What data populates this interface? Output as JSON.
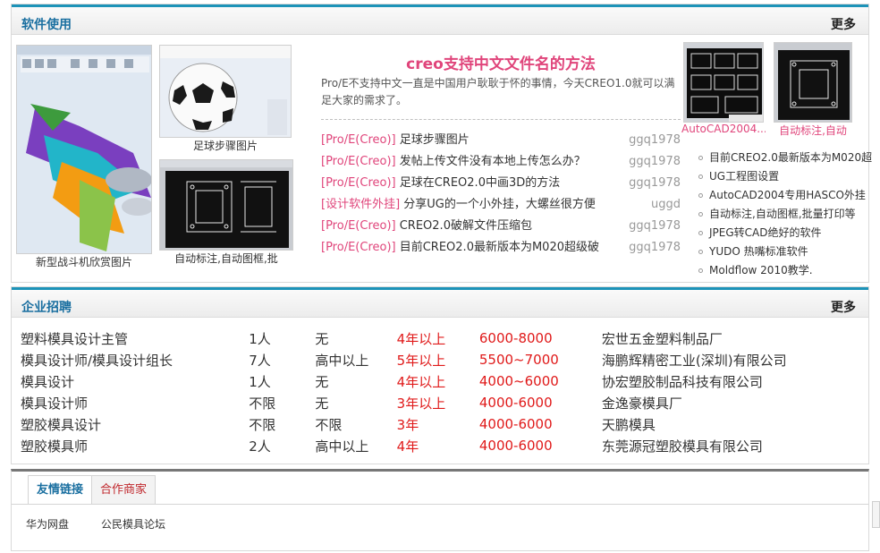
{
  "software": {
    "title": "软件使用",
    "more": "更多",
    "gallery": [
      {
        "caption": "新型战斗机欣赏图片"
      },
      {
        "caption": "足球步骤图片"
      },
      {
        "caption": "自动标注,自动图框,批"
      }
    ],
    "feature": {
      "title": "creo支持中文文件名的方法",
      "desc": "Pro/E不支持中文一直是中国用户耿耿于怀的事情，今天CREO1.0就可以满足大家的需求了。"
    },
    "articles": [
      {
        "tag": "[Pro/E(Creo)]",
        "title": "足球步骤图片",
        "author": "ggq1978"
      },
      {
        "tag": "[Pro/E(Creo)]",
        "title": "发帖上传文件没有本地上传怎么办？",
        "author": "ggq1978"
      },
      {
        "tag": "[Pro/E(Creo)]",
        "title": "足球在CREO2.0中画3D的方法",
        "author": "ggq1978"
      },
      {
        "tag": "[设计软件外挂]",
        "title": "分享UG的一个小外挂，大螺丝很方便",
        "author": "uggd"
      },
      {
        "tag": "[Pro/E(Creo)]",
        "title": "CREO2.0破解文件压缩包",
        "author": "ggq1978"
      },
      {
        "tag": "[Pro/E(Creo)]",
        "title": "目前CREO2.0最新版本为M020超级破",
        "author": "ggq1978"
      }
    ],
    "side_thumbs": [
      {
        "caption": "AutoCAD2004..."
      },
      {
        "caption": "自动标注,自动"
      }
    ],
    "side_list": [
      "目前CREO2.0最新版本为M020超",
      "UG工程图设置",
      "AutoCAD2004专用HASCO外挂",
      "自动标注,自动图框,批量打印等",
      "JPEG转CAD绝好的软件",
      "YUDO 热嘴标准软件",
      "Moldflow 2010教学."
    ]
  },
  "jobs": {
    "title": "企业招聘",
    "more": "更多",
    "rows": [
      {
        "position": "塑料模具设计主管",
        "count": "1人",
        "education": "无",
        "experience": "4年以上",
        "salary": "6000-8000",
        "company": "宏世五金塑料制品厂"
      },
      {
        "position": "模具设计师/模具设计组长",
        "count": "7人",
        "education": "高中以上",
        "experience": "5年以上",
        "salary": "5500~7000",
        "company": "海鹏辉精密工业(深圳)有限公司"
      },
      {
        "position": "模具设计",
        "count": "1人",
        "education": "无",
        "experience": "4年以上",
        "salary": "4000~6000",
        "company": "协宏塑胶制品科技有限公司"
      },
      {
        "position": "模具设计师",
        "count": "不限",
        "education": "无",
        "experience": "3年以上",
        "salary": "4000-6000",
        "company": "金逸豪模具厂"
      },
      {
        "position": "塑胶模具设计",
        "count": "不限",
        "education": "不限",
        "experience": "3年",
        "salary": "4000-6000",
        "company": "天鹏模具"
      },
      {
        "position": "塑胶模具师",
        "count": "2人",
        "education": "高中以上",
        "experience": "4年",
        "salary": "4000-6000",
        "company": "东莞源冠塑胶模具有限公司"
      }
    ]
  },
  "links": {
    "tabs": [
      {
        "label": "友情链接"
      },
      {
        "label": "合作商家"
      }
    ],
    "items": [
      "华为网盘",
      "公民模具论坛"
    ]
  },
  "colors": {
    "accent": "#1d93b8",
    "title_blue": "#1a6fa0",
    "pink": "#e0457b",
    "red": "#e01a1a"
  }
}
